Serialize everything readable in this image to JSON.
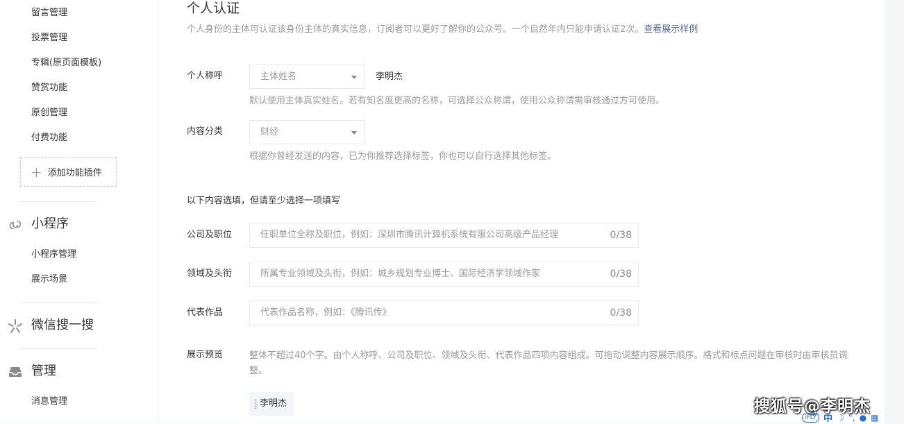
{
  "sidebar": {
    "function_items": [
      {
        "label": "留言管理"
      },
      {
        "label": "投票管理"
      },
      {
        "label": "专辑(原页面模板)"
      },
      {
        "label": "赞赏功能"
      },
      {
        "label": "原创管理"
      },
      {
        "label": "付费功能"
      }
    ],
    "add_plugin_label": "添加功能插件",
    "miniprogram": {
      "title": "小程序",
      "icon": "link-icon",
      "items": [
        {
          "label": "小程序管理"
        },
        {
          "label": "展示场景"
        }
      ]
    },
    "search": {
      "title": "微信搜一搜",
      "icon": "sparkle-icon"
    },
    "manage": {
      "title": "管理",
      "icon": "inbox-icon",
      "items": [
        {
          "label": "消息管理"
        }
      ]
    }
  },
  "main": {
    "title": "个人认证",
    "description": "个人身份的主体可认证该身份主体的真实信息，订阅者可以更好了解你的公众号。一个自然年内只能申请认证2次。",
    "example_link": "查看展示样例",
    "nickname": {
      "label": "个人称呼",
      "select_value": "主体姓名",
      "value": "李明杰",
      "hint": "默认使用主体真实姓名。若有知名度更高的名称，可选择公众称谓，使用公众称谓需审核通过方可使用。"
    },
    "category": {
      "label": "内容分类",
      "select_value": "财经",
      "hint": "根据你曾经发送的内容，已为你推荐选择标签，你也可以自行选择其他标签。"
    },
    "optional_heading": "以下内容选填，但请至少选择一项填写",
    "fields": [
      {
        "label": "公司及职位",
        "placeholder": "任职单位全称及职位，例如：深圳市腾讯计算机系统有限公司高级产品经理",
        "counter": "0/38"
      },
      {
        "label": "领域及头衔",
        "placeholder": "所属专业领域及头衔，例如：城乡规划专业博士、国际经济学领域作家",
        "counter": "0/38"
      },
      {
        "label": "代表作品",
        "placeholder": "代表作品名称，例如：《腾讯传》",
        "counter": "0/38"
      }
    ],
    "preview": {
      "label": "展示预览",
      "description": "整体不超过40个字。由个人称呼、公司及职位、领域及头衔、代表作品四项内容组成。可拖动调整内容展示顺序。格式和标点问题在审核时由审核员调整。",
      "chip": "李明杰"
    }
  },
  "watermark": "搜狐号@李明杰",
  "ime": {
    "brand": "iFLY",
    "mode": "中"
  }
}
